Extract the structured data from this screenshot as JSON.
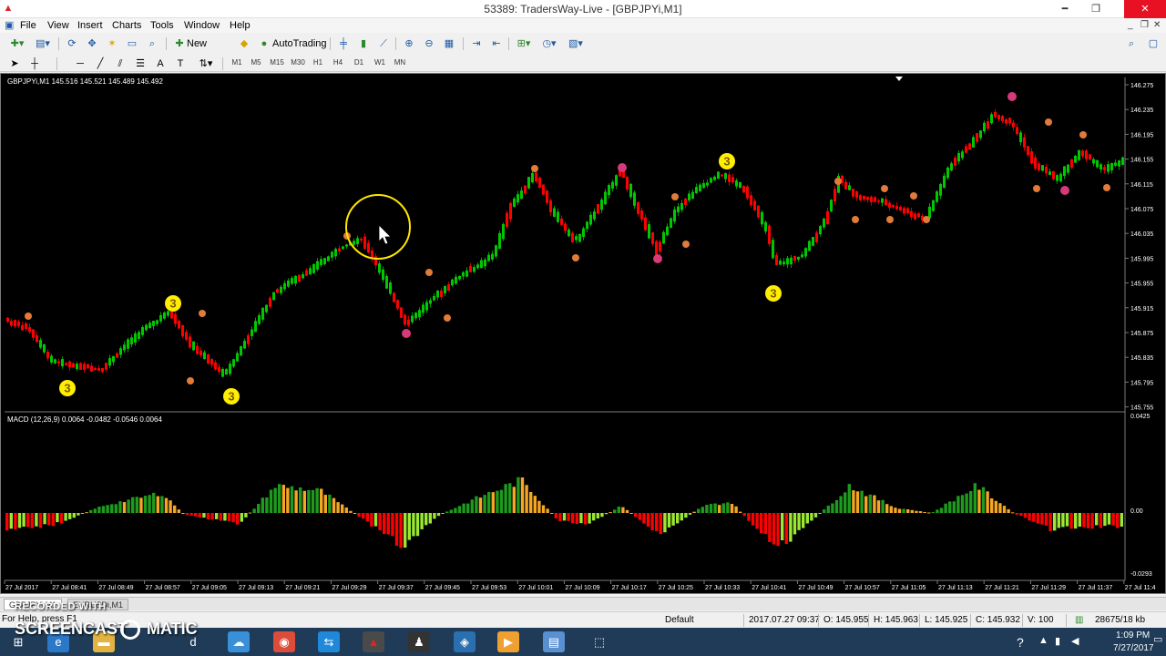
{
  "window": {
    "title": "53389: TradersWay-Live - [GBPJPYi,M1]"
  },
  "menu": [
    "File",
    "View",
    "Insert",
    "Charts",
    "Tools",
    "Window",
    "Help"
  ],
  "toolbar": {
    "new_order_label": "New Order",
    "autotrading_label": "AutoTrading",
    "timeframes": [
      "M1",
      "M5",
      "M15",
      "M30",
      "H1",
      "H4",
      "D1",
      "W1",
      "MN"
    ]
  },
  "chart": {
    "symbol_header": "GBPJPYi,M1  145.516 145.521 145.489 145.492",
    "price_labels": [
      "146.275",
      "146.235",
      "146.195",
      "146.155",
      "146.115",
      "146.075",
      "146.035",
      "145.995",
      "145.955",
      "145.915",
      "145.875",
      "145.835",
      "145.795",
      "145.755"
    ],
    "macd_header": "MACD (12,26,9) 0.0064 -0.0482 -0.0546 0.0064",
    "macd_labels": [
      "0.0425",
      "0.00",
      "-0.0293"
    ],
    "time_labels": [
      "27 Jul 2017",
      "27 Jul 08:41",
      "27 Jul 08:49",
      "27 Jul 08:57",
      "27 Jul 09:05",
      "27 Jul 09:13",
      "27 Jul 09:21",
      "27 Jul 09:29",
      "27 Jul 09:37",
      "27 Jul 09:45",
      "27 Jul 09:53",
      "27 Jul 10:01",
      "27 Jul 10:09",
      "27 Jul 10:17",
      "27 Jul 10:25",
      "27 Jul 10:33",
      "27 Jul 10:41",
      "27 Jul 10:49",
      "27 Jul 10:57",
      "27 Jul 11:05",
      "27 Jul 11:13",
      "27 Jul 11:21",
      "27 Jul 11:29",
      "27 Jul 11:37",
      "27 Jul 11:4"
    ],
    "marker_label": "3",
    "colors": {
      "background": "#000000",
      "bull": "#00c800",
      "bear": "#ff0000",
      "macd_pos_strong": "#1e9b1e",
      "macd_pos_fade": "#f5a623",
      "macd_neg_strong": "#ff0000",
      "macd_neg_fade": "#9be832",
      "marker_orange": "#e07b39",
      "marker_pink": "#d63a7a",
      "marker_yellow": "#ffee00",
      "cursor_highlight": "#ffe600"
    }
  },
  "tabs": [
    "GBPJPYi,M1",
    "EURUSDi,M1"
  ],
  "status": {
    "help_text": "For Help, press F1",
    "profile": "Default",
    "datetime": "2017.07.27 09:37",
    "open": "O: 145.955",
    "high": "H: 145.963",
    "low": "L: 145.925",
    "close": "C: 145.932",
    "volume": "V: 100",
    "traffic": "28675/18 kb"
  },
  "taskbar": {
    "time": "1:09 PM",
    "date": "7/27/2017"
  },
  "watermark": {
    "line1": "RECORDED WITH",
    "line2": "SCREENCAST",
    "line3": "MATIC"
  }
}
